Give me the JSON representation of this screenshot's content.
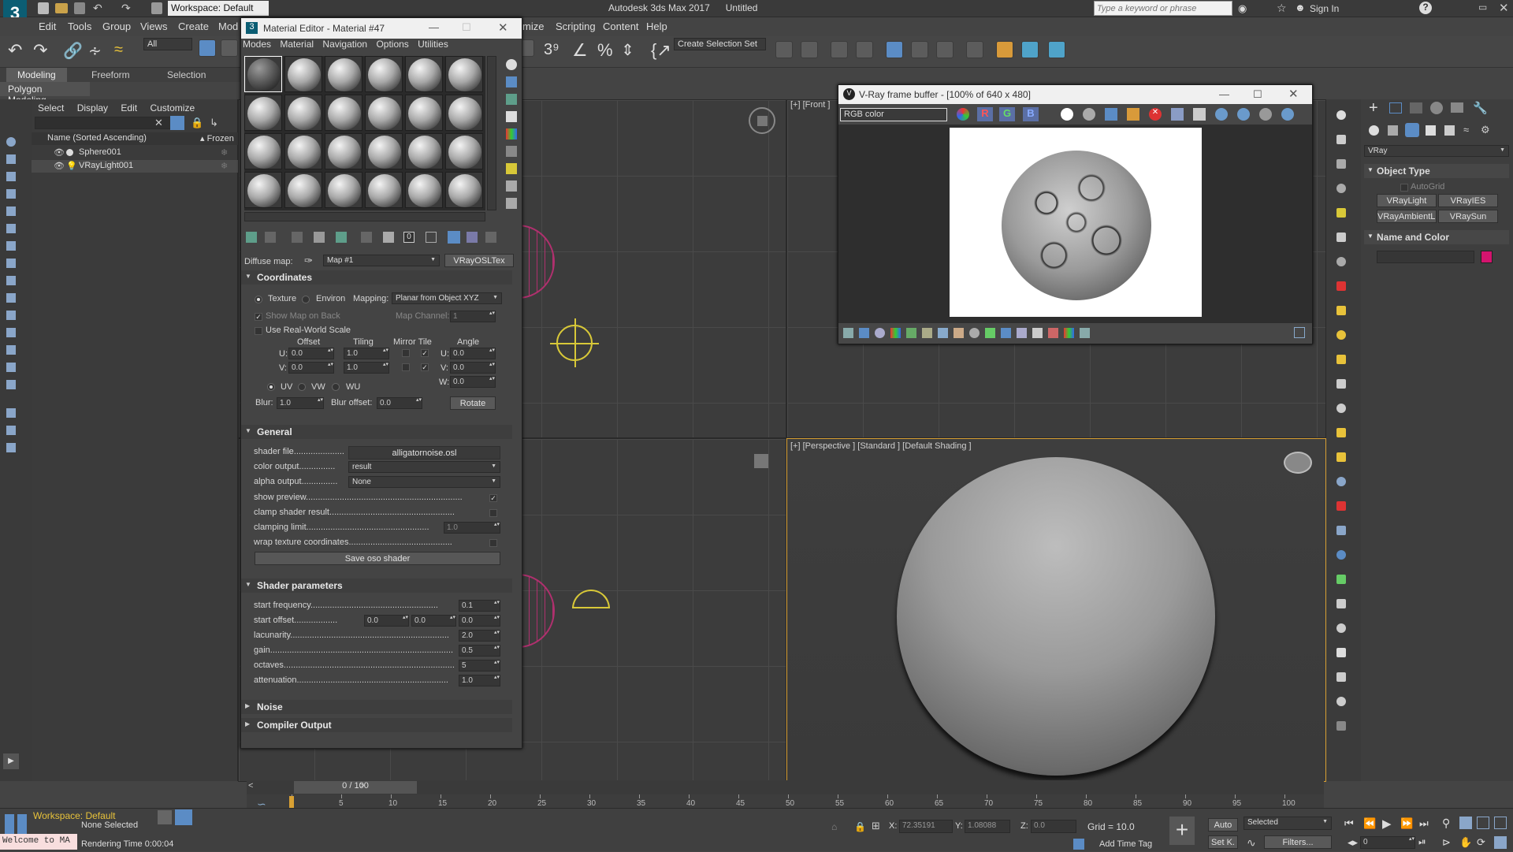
{
  "app": {
    "title": "Autodesk 3ds Max 2017",
    "doc": "Untitled",
    "workspace": "Workspace: Default",
    "search_placeholder": "Type a keyword or phrase",
    "sign_in": "Sign In"
  },
  "menu": [
    "Edit",
    "Tools",
    "Group",
    "Views",
    "Create",
    "Mod",
    "mize",
    "Scripting",
    "Content",
    "Help"
  ],
  "toolbar": {
    "filter": "All",
    "selection_set": "Create Selection Set"
  },
  "ribbon": {
    "tabs": [
      "Modeling",
      "Freeform",
      "Selection"
    ],
    "sub": "Polygon Modeling"
  },
  "explorer": {
    "menu": [
      "Select",
      "Display",
      "Edit",
      "Customize"
    ],
    "col_name": "Name (Sorted Ascending)",
    "col_frozen": "▴ Frozen",
    "items": [
      "Sphere001",
      "VRayLight001"
    ]
  },
  "mat": {
    "title": "Material Editor - Material #47",
    "menu": [
      "Modes",
      "Material",
      "Navigation",
      "Options",
      "Utilities"
    ],
    "diffuse_label": "Diffuse map:",
    "map_name": "Map #1",
    "map_type": "VRayOSLTex",
    "coords": {
      "head": "Coordinates",
      "texture": "Texture",
      "environ": "Environ",
      "mapping_lbl": "Mapping:",
      "mapping": "Planar from Object XYZ",
      "show_map": "Show Map on Back",
      "map_channel_lbl": "Map Channel:",
      "map_channel": "1",
      "real_world": "Use Real-World Scale",
      "offset": "Offset",
      "tiling": "Tiling",
      "mirror_tile": "Mirror Tile",
      "angle": "Angle",
      "u": "U:",
      "v": "V:",
      "w": "W:",
      "u_off": "0.0",
      "v_off": "0.0",
      "u_til": "1.0",
      "v_til": "1.0",
      "u_ang": "0.0",
      "v_ang": "0.0",
      "w_ang": "0.0",
      "uv": "UV",
      "vw": "VW",
      "wu": "WU",
      "blur_lbl": "Blur:",
      "blur": "1.0",
      "blur_off_lbl": "Blur offset:",
      "blur_off": "0.0",
      "rotate": "Rotate"
    },
    "general": {
      "head": "General",
      "shader_file_lbl": "shader file",
      "shader_file": "alligatornoise.osl",
      "color_output_lbl": "color output",
      "color_output": "result",
      "alpha_output_lbl": "alpha output",
      "alpha_output": "None",
      "show_preview": "show preview",
      "clamp": "clamp shader result",
      "clamp_limit_lbl": "clamping limit",
      "clamp_limit": "1.0",
      "wrap": "wrap texture coordinates",
      "save": "Save oso shader"
    },
    "shader": {
      "head": "Shader parameters",
      "start_freq_lbl": "start frequency",
      "start_freq": "0.1",
      "start_off_lbl": "start offset",
      "so1": "0.0",
      "so2": "0.0",
      "so3": "0.0",
      "lac_lbl": "lacunarity",
      "lac": "2.0",
      "gain_lbl": "gain",
      "gain": "0.5",
      "oct_lbl": "octaves",
      "oct": "5",
      "att_lbl": "attenuation",
      "att": "1.0"
    },
    "noise_head": "Noise",
    "compiler_head": "Compiler Output"
  },
  "viewports": {
    "front": "[+] [Front ]",
    "persp": "[+] [Perspective ] [Standard ] [Default Shading ]"
  },
  "vfb": {
    "title": "V-Ray frame buffer - [100% of 640 x 480]",
    "channel": "RGB color",
    "r": "R",
    "g": "G",
    "b": "B"
  },
  "cmd": {
    "renderer": "VRay",
    "object_type": "Object Type",
    "autogrid": "AutoGrid",
    "buttons": [
      "VRayLight",
      "VRayIES",
      "VRayAmbientLig",
      "VRaySun"
    ],
    "name_color": "Name and Color",
    "swatch": "#d4146e"
  },
  "timeline": {
    "frame": "0 / 100",
    "ticks": [
      "0",
      "5",
      "10",
      "15",
      "20",
      "25",
      "30",
      "35",
      "40",
      "45",
      "50",
      "55",
      "60",
      "65",
      "70",
      "75",
      "80",
      "85",
      "90",
      "95",
      "100"
    ]
  },
  "status": {
    "workspace": "Workspace: Default",
    "listener": "Welcome to MA",
    "selection": "None Selected",
    "render_time": "Rendering Time  0:00:04",
    "x_lbl": "X:",
    "x": "72.35191",
    "y_lbl": "Y:",
    "y": "1.08088",
    "z_lbl": "Z:",
    "z": "0.0",
    "grid": "Grid = 10.0",
    "add_tag": "Add Time Tag",
    "auto": "Auto",
    "setk": "Set K.",
    "selected": "Selected",
    "filters": "Filters...",
    "frame": "0"
  }
}
